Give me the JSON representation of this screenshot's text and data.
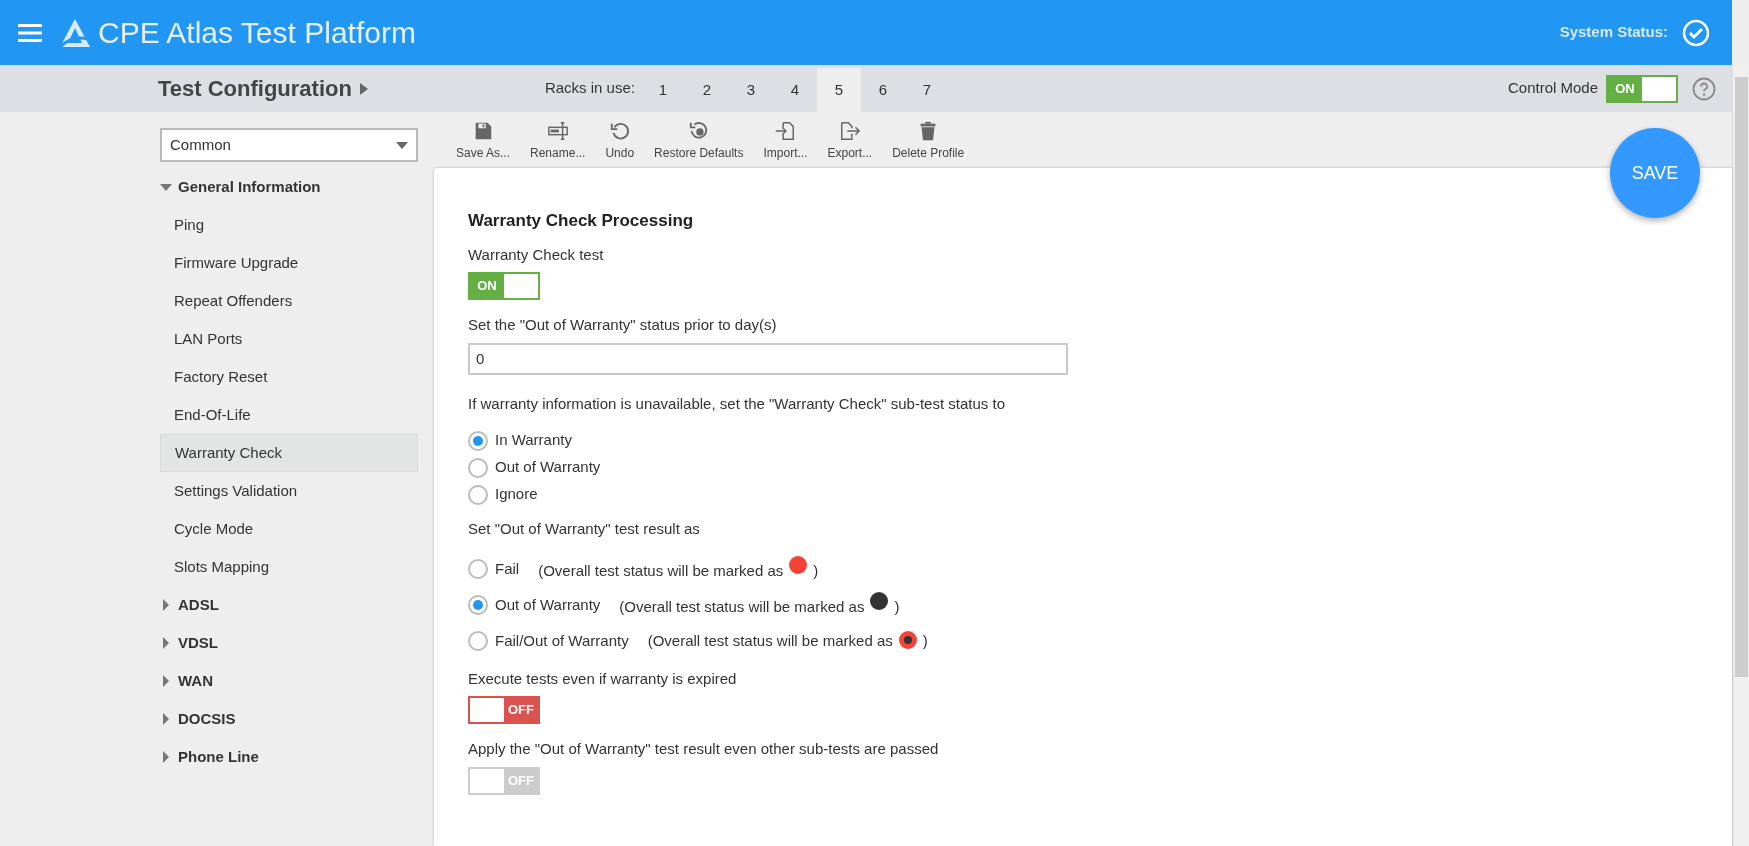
{
  "header": {
    "title": "CPE Atlas Test Platform",
    "status_label": "System Status:"
  },
  "subheader": {
    "title": "Test Configuration",
    "racks_label": "Racks in use:",
    "racks": [
      {
        "label": "1",
        "selected": false
      },
      {
        "label": "2",
        "selected": false
      },
      {
        "label": "3",
        "selected": false
      },
      {
        "label": "4",
        "selected": false
      },
      {
        "label": "5",
        "selected": true
      },
      {
        "label": "6",
        "selected": false
      },
      {
        "label": "7",
        "selected": false
      }
    ],
    "control_mode": {
      "label": "Control Mode",
      "on": true,
      "toggle_label": "ON"
    }
  },
  "sidebar": {
    "profile": "Common",
    "tree": [
      {
        "label": "General Information",
        "expanded": true,
        "children": [
          {
            "label": "Ping",
            "selected": false
          },
          {
            "label": "Firmware Upgrade",
            "selected": false
          },
          {
            "label": "Repeat Offenders",
            "selected": false
          },
          {
            "label": "LAN Ports",
            "selected": false
          },
          {
            "label": "Factory Reset",
            "selected": false
          },
          {
            "label": "End-Of-Life",
            "selected": false
          },
          {
            "label": "Warranty Check",
            "selected": true
          },
          {
            "label": "Settings Validation",
            "selected": false
          },
          {
            "label": "Cycle Mode",
            "selected": false
          },
          {
            "label": "Slots Mapping",
            "selected": false
          }
        ]
      },
      {
        "label": "ADSL",
        "expanded": false
      },
      {
        "label": "VDSL",
        "expanded": false
      },
      {
        "label": "WAN",
        "expanded": false
      },
      {
        "label": "DOCSIS",
        "expanded": false
      },
      {
        "label": "Phone Line",
        "expanded": false
      }
    ]
  },
  "toolbar": [
    {
      "kind": "save",
      "label": "Save As..."
    },
    {
      "kind": "rename",
      "label": "Rename..."
    },
    {
      "kind": "undo",
      "label": "Undo"
    },
    {
      "kind": "restore",
      "label": "Restore Defaults"
    },
    {
      "kind": "import",
      "label": "Import..."
    },
    {
      "kind": "export",
      "label": "Export..."
    },
    {
      "kind": "delete",
      "label": "Delete Profile"
    }
  ],
  "save_button": "SAVE",
  "form": {
    "title": "Warranty Check Processing",
    "fields": [
      {
        "kind": "toggle",
        "label": "Warranty Check test",
        "on": true,
        "disabled": false,
        "toggle_label": "ON"
      },
      {
        "kind": "input",
        "label": "Set the \"Out of Warranty\" status prior to day(s)",
        "value": "0"
      },
      {
        "kind": "radio",
        "label": "If warranty information is unavailable, set the \"Warranty Check\" sub-test status to",
        "options": [
          {
            "label": "In Warranty",
            "selected": true
          },
          {
            "label": "Out of Warranty",
            "selected": false
          },
          {
            "label": "Ignore",
            "selected": false
          }
        ]
      },
      {
        "kind": "radio",
        "label": "Set \"Out of Warranty\" test result as",
        "options": [
          {
            "label": "Fail",
            "note": "(Overall test status will be marked as",
            "close": ")",
            "marker": {
              "kind": "solid",
              "color": "#f44336"
            },
            "selected": false
          },
          {
            "label": "Out of Warranty",
            "note": "(Overall test status will be marked as",
            "close": ")",
            "marker": {
              "kind": "solid",
              "color": "#333333"
            },
            "selected": true
          },
          {
            "label": "Fail/Out of Warranty",
            "note": "(Overall test status will be marked as",
            "close": ")",
            "marker": {
              "kind": "ring",
              "color": "#f44336"
            },
            "selected": false
          }
        ]
      },
      {
        "kind": "toggle",
        "label": "Execute tests even if warranty is expired",
        "on": false,
        "disabled": false,
        "toggle_label": "OFF"
      },
      {
        "kind": "toggle",
        "label": "Apply the \"Out of Warranty\" test result even other sub-tests are passed",
        "on": false,
        "disabled": true,
        "toggle_label": "OFF"
      }
    ]
  }
}
